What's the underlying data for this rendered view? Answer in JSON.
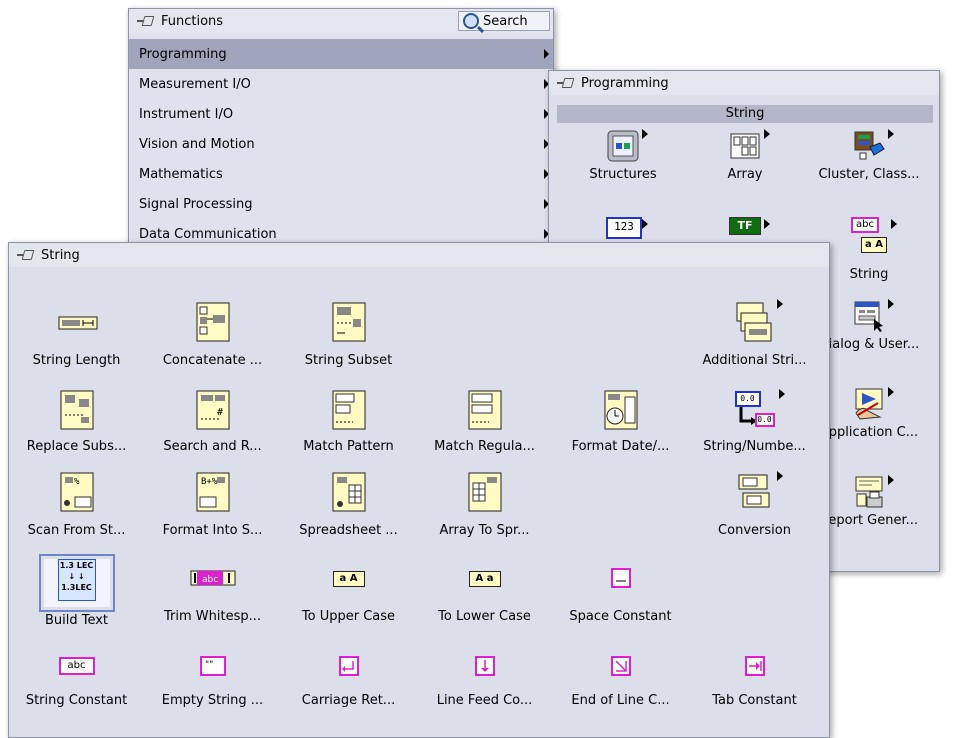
{
  "functions_palette": {
    "title": "Functions",
    "search_label": "Search",
    "categories": [
      {
        "label": "Programming"
      },
      {
        "label": "Measurement I/O"
      },
      {
        "label": "Instrument I/O"
      },
      {
        "label": "Vision and Motion"
      },
      {
        "label": "Mathematics"
      },
      {
        "label": "Signal Processing"
      },
      {
        "label": "Data Communication"
      }
    ],
    "active_category": "Programming"
  },
  "programming_palette": {
    "title": "Programming",
    "highlight_label": "String",
    "items": [
      {
        "label": "Structures",
        "icon": "structures-icon"
      },
      {
        "label": "Array",
        "icon": "array-icon"
      },
      {
        "label": "Cluster, Class...",
        "icon": "cluster-class-icon"
      },
      {
        "label": "",
        "icon": "numeric-icon"
      },
      {
        "label": "",
        "icon": "boolean-icon"
      },
      {
        "label": "String",
        "icon": "string-icon"
      },
      {
        "label": "Dialog & User...",
        "icon": "dialog-icon"
      },
      {
        "label": "Application C...",
        "icon": "application-control-icon"
      },
      {
        "label": "Report Gener...",
        "icon": "report-generation-icon"
      }
    ]
  },
  "string_palette": {
    "title": "String",
    "items": [
      {
        "label": "String Length",
        "icon": "string-length-icon"
      },
      {
        "label": "Concatenate ...",
        "icon": "concatenate-icon"
      },
      {
        "label": "String Subset",
        "icon": "string-subset-icon"
      },
      {
        "label": "Additional Stri...",
        "icon": "additional-string-icon"
      },
      {
        "label": "Replace Subs...",
        "icon": "replace-substring-icon"
      },
      {
        "label": "Search and R...",
        "icon": "search-replace-icon"
      },
      {
        "label": "Match Pattern",
        "icon": "match-pattern-icon"
      },
      {
        "label": "Match Regula...",
        "icon": "match-regex-icon"
      },
      {
        "label": "Format Date/...",
        "icon": "format-date-icon"
      },
      {
        "label": "String/Numbe...",
        "icon": "string-number-icon"
      },
      {
        "label": "Scan From St...",
        "icon": "scan-from-string-icon"
      },
      {
        "label": "Format Into S...",
        "icon": "format-into-string-icon"
      },
      {
        "label": "Spreadsheet ...",
        "icon": "spreadsheet-icon"
      },
      {
        "label": "Array To Spr...",
        "icon": "array-to-spreadsheet-icon"
      },
      {
        "label": "Conversion",
        "icon": "conversion-icon"
      },
      {
        "label": "Build Text",
        "icon": "build-text-icon"
      },
      {
        "label": "Trim Whitesp...",
        "icon": "trim-whitespace-icon"
      },
      {
        "label": "To Upper Case",
        "icon": "to-upper-icon"
      },
      {
        "label": "To Lower Case",
        "icon": "to-lower-icon"
      },
      {
        "label": "Space Constant",
        "icon": "space-constant-icon"
      },
      {
        "label": "String Constant",
        "icon": "string-constant-icon"
      },
      {
        "label": "Empty String ...",
        "icon": "empty-string-icon"
      },
      {
        "label": "Carriage Ret...",
        "icon": "carriage-return-icon"
      },
      {
        "label": "Line Feed Co...",
        "icon": "line-feed-icon"
      },
      {
        "label": "End of Line C...",
        "icon": "end-of-line-icon"
      },
      {
        "label": "Tab Constant",
        "icon": "tab-constant-icon"
      }
    ],
    "selected_item": "Build Text"
  },
  "icon_text": {
    "numeric": "123",
    "boolean": "TF",
    "abc": "abc",
    "aA": "a A",
    "Aa": "A a",
    "num1": "0.0",
    "build_top": "1.3 LEC",
    "build_bot": "1.3LEC"
  },
  "colors": {
    "palette_bg": "#dcdfea",
    "active_row": "#a0a4bc",
    "vi_yellow": "#fffbc3",
    "string_pink": "#e020d0"
  }
}
